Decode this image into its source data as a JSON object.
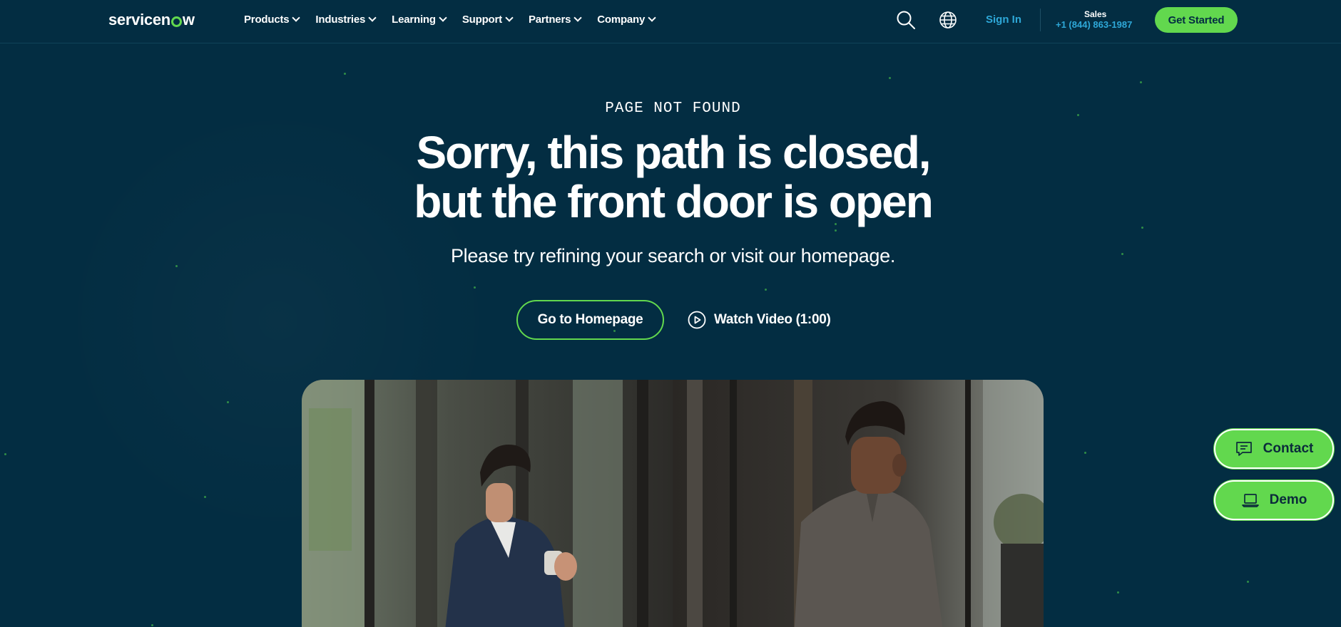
{
  "header": {
    "logo_text_a": "servicen",
    "logo_text_b": "w",
    "nav": [
      {
        "label": "Products"
      },
      {
        "label": "Industries"
      },
      {
        "label": "Learning"
      },
      {
        "label": "Support"
      },
      {
        "label": "Partners"
      },
      {
        "label": "Company"
      }
    ],
    "sign_in": "Sign In",
    "sales_label": "Sales",
    "sales_phone": "+1 (844) 863-1987",
    "get_started": "Get Started"
  },
  "hero": {
    "eyebrow": "PAGE NOT FOUND",
    "headline_line1": "Sorry, this path is closed,",
    "headline_line2": "but the front door is open",
    "subtext": "Please try refining your search or visit our homepage.",
    "primary_cta": "Go to Homepage",
    "video_cta": "Watch Video (1:00)"
  },
  "side": {
    "contact": "Contact",
    "demo": "Demo"
  },
  "colors": {
    "background": "#032d42",
    "accent_green": "#62d84e",
    "link_blue": "#2ea8d8"
  },
  "icons": {
    "search": "search-icon",
    "globe": "globe-icon",
    "play": "play-circle-icon",
    "chat": "chat-icon",
    "laptop": "laptop-icon"
  }
}
